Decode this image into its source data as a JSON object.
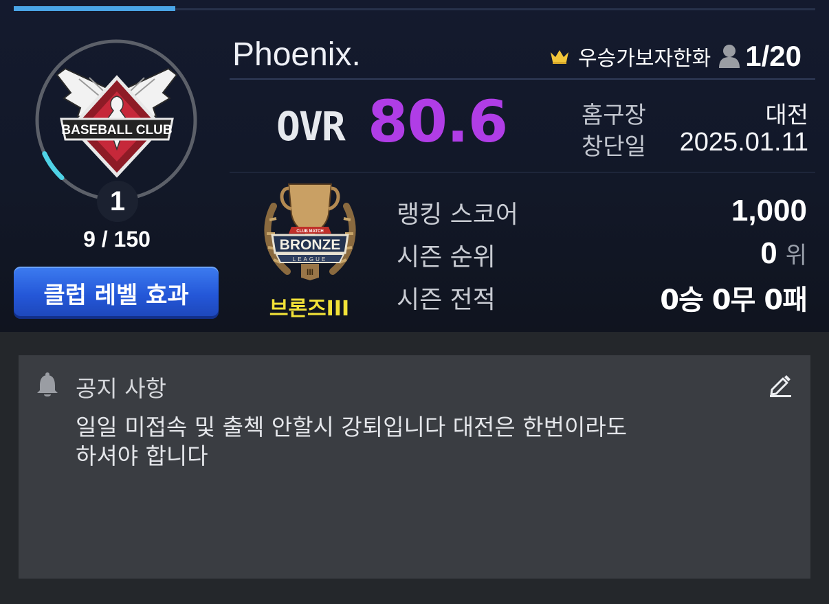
{
  "club": {
    "level": "1",
    "level_progress": 0.06,
    "exp": "9 / 150",
    "level_button": "클럽 레벨 효과",
    "logo_text": "BASEBALL CLUB",
    "name": "Phoenix.",
    "owner": "우승가보자한화",
    "members": "1/20",
    "ovr_label": "OVR",
    "ovr_value": "80.6",
    "home_label": "홈구장",
    "home_value": "대전",
    "founded_label": "창단일",
    "founded_value": "2025.01.11"
  },
  "league": {
    "emblem_top": "CLUB MATCH",
    "emblem_main": "BRONZE",
    "emblem_sub": "LEAGUE",
    "emblem_tier": "III",
    "name": "브론즈III",
    "stats": {
      "ranking_score_label": "랭킹 스코어",
      "ranking_score": "1,000",
      "season_rank_label": "시즌 순위",
      "season_rank": "0",
      "season_rank_unit": "위",
      "season_record_label": "시즌 전적",
      "season_record": "0승 0무 0패"
    }
  },
  "notice": {
    "title": "공지 사항",
    "body": "일일 미접속 및 출첵 안할시 강퇴입니다 대전은 한번이라도\n하셔야 합니다"
  },
  "icons": {
    "crown": "crown-icon",
    "member": "member-icon",
    "bell": "bell-icon",
    "edit": "edit-icon"
  },
  "colors": {
    "ovr": "#b03de6",
    "league_name": "#f2e238",
    "level_button": "#2c63e0",
    "tab_active": "#4aa5e6"
  }
}
